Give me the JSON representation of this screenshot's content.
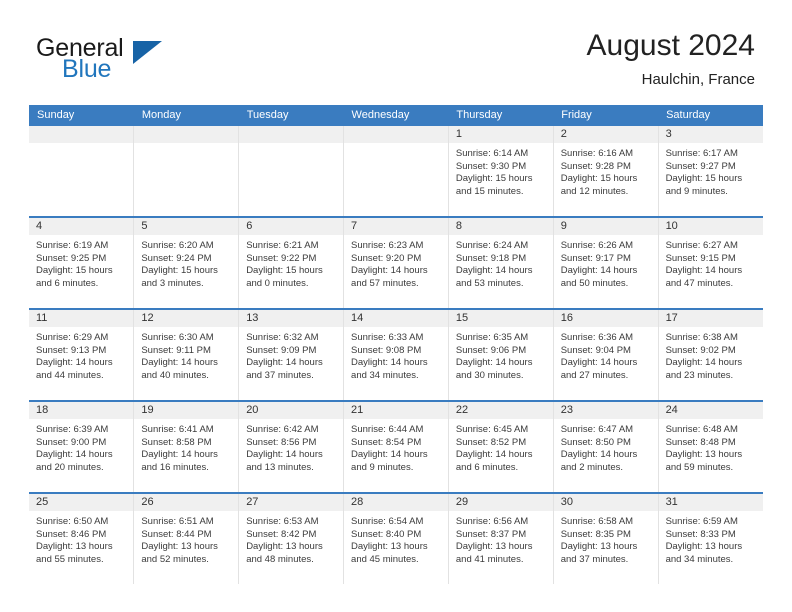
{
  "brand": {
    "word_general": "General",
    "word_blue": "Blue",
    "triangle_color": "#1763a6",
    "blue_color": "#2176bd"
  },
  "header": {
    "month_title": "August 2024",
    "location": "Haulchin, France"
  },
  "theme": {
    "header_blue": "#3a7cc0",
    "band_gray": "#f0f0f0",
    "text_dark": "#222222"
  },
  "weekdays": [
    "Sunday",
    "Monday",
    "Tuesday",
    "Wednesday",
    "Thursday",
    "Friday",
    "Saturday"
  ],
  "weeks": [
    [
      {
        "day": "",
        "empty": true
      },
      {
        "day": "",
        "empty": true
      },
      {
        "day": "",
        "empty": true
      },
      {
        "day": "",
        "empty": true
      },
      {
        "day": "1",
        "sunrise": "Sunrise: 6:14 AM",
        "sunset": "Sunset: 9:30 PM",
        "daylight1": "Daylight: 15 hours",
        "daylight2": "and 15 minutes."
      },
      {
        "day": "2",
        "sunrise": "Sunrise: 6:16 AM",
        "sunset": "Sunset: 9:28 PM",
        "daylight1": "Daylight: 15 hours",
        "daylight2": "and 12 minutes."
      },
      {
        "day": "3",
        "sunrise": "Sunrise: 6:17 AM",
        "sunset": "Sunset: 9:27 PM",
        "daylight1": "Daylight: 15 hours",
        "daylight2": "and 9 minutes."
      }
    ],
    [
      {
        "day": "4",
        "sunrise": "Sunrise: 6:19 AM",
        "sunset": "Sunset: 9:25 PM",
        "daylight1": "Daylight: 15 hours",
        "daylight2": "and 6 minutes."
      },
      {
        "day": "5",
        "sunrise": "Sunrise: 6:20 AM",
        "sunset": "Sunset: 9:24 PM",
        "daylight1": "Daylight: 15 hours",
        "daylight2": "and 3 minutes."
      },
      {
        "day": "6",
        "sunrise": "Sunrise: 6:21 AM",
        "sunset": "Sunset: 9:22 PM",
        "daylight1": "Daylight: 15 hours",
        "daylight2": "and 0 minutes."
      },
      {
        "day": "7",
        "sunrise": "Sunrise: 6:23 AM",
        "sunset": "Sunset: 9:20 PM",
        "daylight1": "Daylight: 14 hours",
        "daylight2": "and 57 minutes."
      },
      {
        "day": "8",
        "sunrise": "Sunrise: 6:24 AM",
        "sunset": "Sunset: 9:18 PM",
        "daylight1": "Daylight: 14 hours",
        "daylight2": "and 53 minutes."
      },
      {
        "day": "9",
        "sunrise": "Sunrise: 6:26 AM",
        "sunset": "Sunset: 9:17 PM",
        "daylight1": "Daylight: 14 hours",
        "daylight2": "and 50 minutes."
      },
      {
        "day": "10",
        "sunrise": "Sunrise: 6:27 AM",
        "sunset": "Sunset: 9:15 PM",
        "daylight1": "Daylight: 14 hours",
        "daylight2": "and 47 minutes."
      }
    ],
    [
      {
        "day": "11",
        "sunrise": "Sunrise: 6:29 AM",
        "sunset": "Sunset: 9:13 PM",
        "daylight1": "Daylight: 14 hours",
        "daylight2": "and 44 minutes."
      },
      {
        "day": "12",
        "sunrise": "Sunrise: 6:30 AM",
        "sunset": "Sunset: 9:11 PM",
        "daylight1": "Daylight: 14 hours",
        "daylight2": "and 40 minutes."
      },
      {
        "day": "13",
        "sunrise": "Sunrise: 6:32 AM",
        "sunset": "Sunset: 9:09 PM",
        "daylight1": "Daylight: 14 hours",
        "daylight2": "and 37 minutes."
      },
      {
        "day": "14",
        "sunrise": "Sunrise: 6:33 AM",
        "sunset": "Sunset: 9:08 PM",
        "daylight1": "Daylight: 14 hours",
        "daylight2": "and 34 minutes."
      },
      {
        "day": "15",
        "sunrise": "Sunrise: 6:35 AM",
        "sunset": "Sunset: 9:06 PM",
        "daylight1": "Daylight: 14 hours",
        "daylight2": "and 30 minutes."
      },
      {
        "day": "16",
        "sunrise": "Sunrise: 6:36 AM",
        "sunset": "Sunset: 9:04 PM",
        "daylight1": "Daylight: 14 hours",
        "daylight2": "and 27 minutes."
      },
      {
        "day": "17",
        "sunrise": "Sunrise: 6:38 AM",
        "sunset": "Sunset: 9:02 PM",
        "daylight1": "Daylight: 14 hours",
        "daylight2": "and 23 minutes."
      }
    ],
    [
      {
        "day": "18",
        "sunrise": "Sunrise: 6:39 AM",
        "sunset": "Sunset: 9:00 PM",
        "daylight1": "Daylight: 14 hours",
        "daylight2": "and 20 minutes."
      },
      {
        "day": "19",
        "sunrise": "Sunrise: 6:41 AM",
        "sunset": "Sunset: 8:58 PM",
        "daylight1": "Daylight: 14 hours",
        "daylight2": "and 16 minutes."
      },
      {
        "day": "20",
        "sunrise": "Sunrise: 6:42 AM",
        "sunset": "Sunset: 8:56 PM",
        "daylight1": "Daylight: 14 hours",
        "daylight2": "and 13 minutes."
      },
      {
        "day": "21",
        "sunrise": "Sunrise: 6:44 AM",
        "sunset": "Sunset: 8:54 PM",
        "daylight1": "Daylight: 14 hours",
        "daylight2": "and 9 minutes."
      },
      {
        "day": "22",
        "sunrise": "Sunrise: 6:45 AM",
        "sunset": "Sunset: 8:52 PM",
        "daylight1": "Daylight: 14 hours",
        "daylight2": "and 6 minutes."
      },
      {
        "day": "23",
        "sunrise": "Sunrise: 6:47 AM",
        "sunset": "Sunset: 8:50 PM",
        "daylight1": "Daylight: 14 hours",
        "daylight2": "and 2 minutes."
      },
      {
        "day": "24",
        "sunrise": "Sunrise: 6:48 AM",
        "sunset": "Sunset: 8:48 PM",
        "daylight1": "Daylight: 13 hours",
        "daylight2": "and 59 minutes."
      }
    ],
    [
      {
        "day": "25",
        "sunrise": "Sunrise: 6:50 AM",
        "sunset": "Sunset: 8:46 PM",
        "daylight1": "Daylight: 13 hours",
        "daylight2": "and 55 minutes."
      },
      {
        "day": "26",
        "sunrise": "Sunrise: 6:51 AM",
        "sunset": "Sunset: 8:44 PM",
        "daylight1": "Daylight: 13 hours",
        "daylight2": "and 52 minutes."
      },
      {
        "day": "27",
        "sunrise": "Sunrise: 6:53 AM",
        "sunset": "Sunset: 8:42 PM",
        "daylight1": "Daylight: 13 hours",
        "daylight2": "and 48 minutes."
      },
      {
        "day": "28",
        "sunrise": "Sunrise: 6:54 AM",
        "sunset": "Sunset: 8:40 PM",
        "daylight1": "Daylight: 13 hours",
        "daylight2": "and 45 minutes."
      },
      {
        "day": "29",
        "sunrise": "Sunrise: 6:56 AM",
        "sunset": "Sunset: 8:37 PM",
        "daylight1": "Daylight: 13 hours",
        "daylight2": "and 41 minutes."
      },
      {
        "day": "30",
        "sunrise": "Sunrise: 6:58 AM",
        "sunset": "Sunset: 8:35 PM",
        "daylight1": "Daylight: 13 hours",
        "daylight2": "and 37 minutes."
      },
      {
        "day": "31",
        "sunrise": "Sunrise: 6:59 AM",
        "sunset": "Sunset: 8:33 PM",
        "daylight1": "Daylight: 13 hours",
        "daylight2": "and 34 minutes."
      }
    ]
  ]
}
